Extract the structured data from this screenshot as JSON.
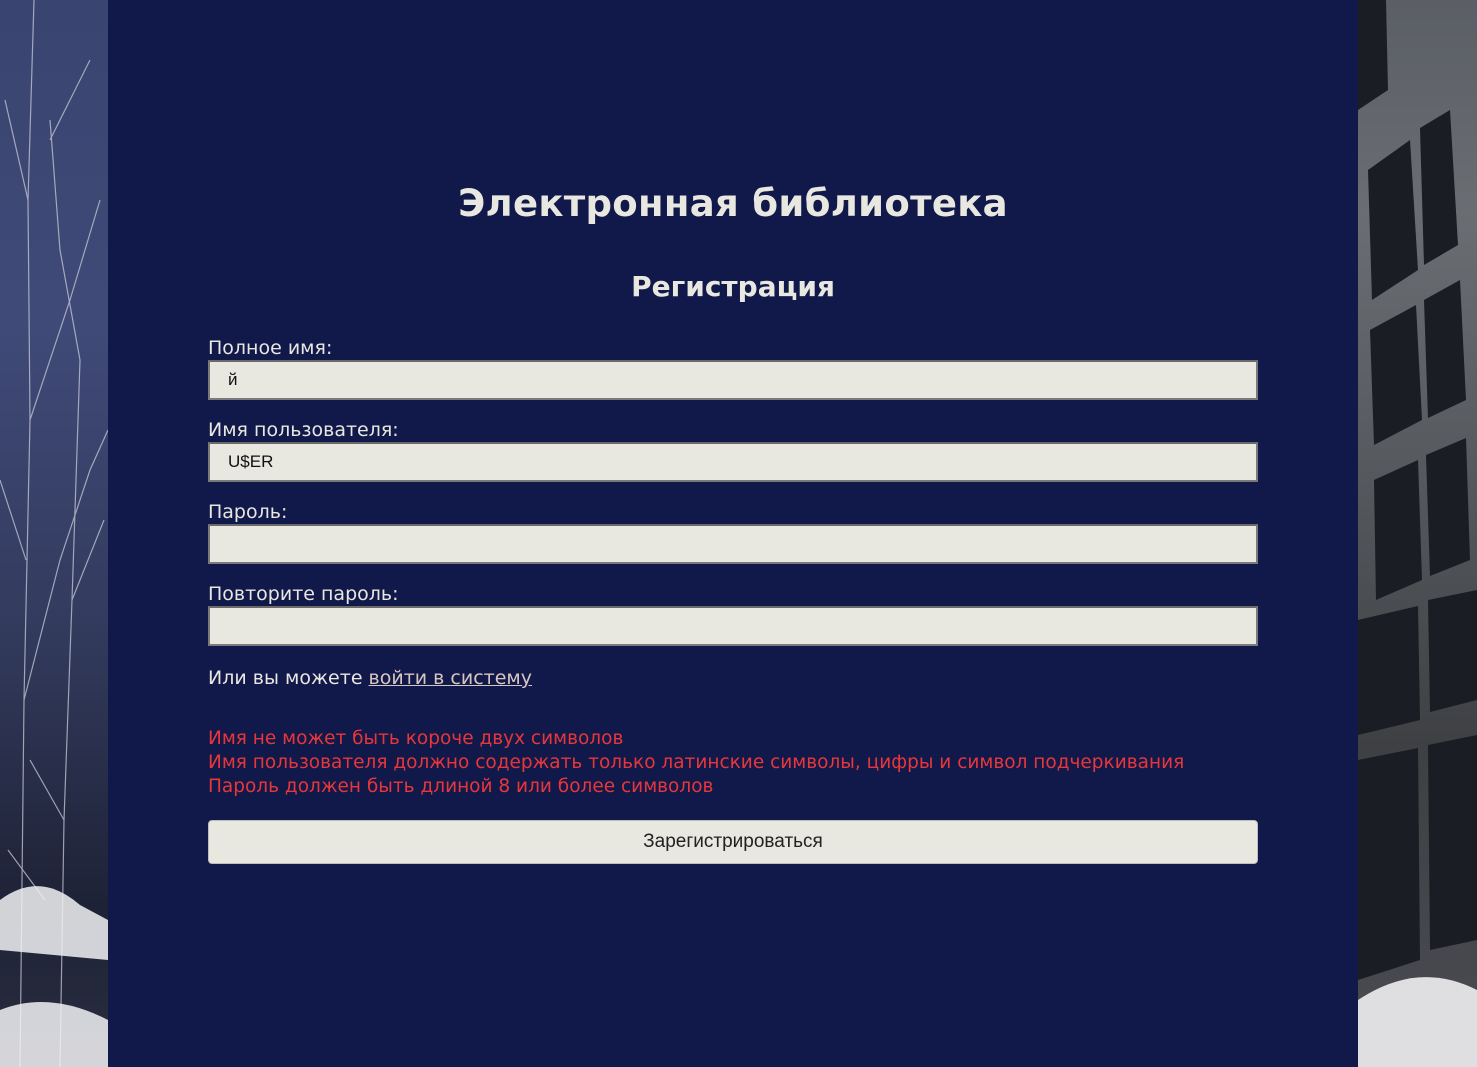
{
  "site": {
    "title": "Электронная библиотека"
  },
  "form": {
    "title": "Регистрация",
    "full_name": {
      "label": "Полное имя:",
      "value": "й"
    },
    "username": {
      "label": "Имя пользователя:",
      "value": "U$ER"
    },
    "password": {
      "label": "Пароль:",
      "value": ""
    },
    "password_repeat": {
      "label": "Повторите пароль:",
      "value": ""
    },
    "login_prompt": "Или вы можете ",
    "login_link": "войти в систему",
    "errors": [
      "Имя не может быть короче двух символов",
      "Имя пользователя должно содержать только латинские символы, цифры и символ подчеркивания",
      "Пароль должен быть длиной 8 или более символов"
    ],
    "submit_label": "Зарегистрироваться"
  },
  "colors": {
    "panel_background": "#11184a",
    "text": "#e8e7e0",
    "input_background": "#e8e7e0",
    "error": "#e8373a",
    "link": "#d9c6c0"
  }
}
